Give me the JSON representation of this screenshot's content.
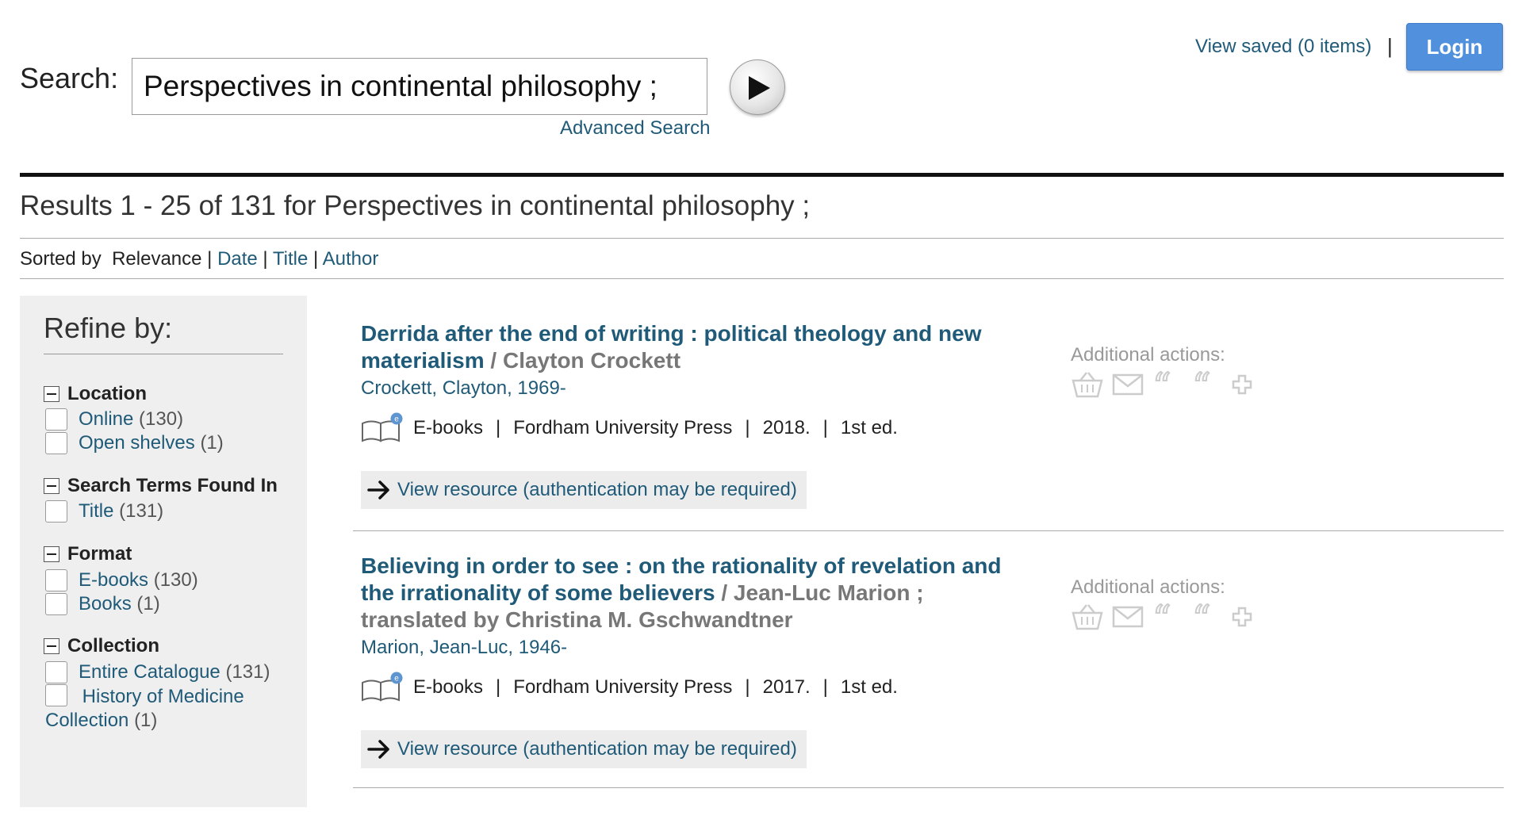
{
  "header": {
    "search_label": "Search:",
    "search_value": "Perspectives in continental philosophy ;",
    "advanced_search": "Advanced Search",
    "view_saved": "View saved (0 items)",
    "separator": "|",
    "login": "Login"
  },
  "results_header": {
    "title": "Results 1 - 25 of 131 for Perspectives in continental philosophy ;",
    "sorted_by": "Sorted by",
    "sort_current": "Relevance",
    "sort_options": [
      "Date",
      "Title",
      "Author"
    ]
  },
  "sidebar": {
    "title": "Refine by:",
    "facets": [
      {
        "heading": "Location",
        "items": [
          {
            "label": "Online",
            "count": "(130)"
          },
          {
            "label": "Open shelves",
            "count": "(1)"
          }
        ]
      },
      {
        "heading": "Search Terms Found In",
        "items": [
          {
            "label": "Title",
            "count": "(131)"
          }
        ]
      },
      {
        "heading": "Format",
        "items": [
          {
            "label": "E-books",
            "count": "(130)"
          },
          {
            "label": "Books",
            "count": "(1)"
          }
        ]
      },
      {
        "heading": "Collection",
        "items": [
          {
            "label": "Entire Catalogue",
            "count": "(131)"
          },
          {
            "label": "History of Medicine Collection",
            "count": "(1)"
          }
        ]
      }
    ]
  },
  "results": [
    {
      "title": "Derrida after the end of writing : political theology and new materialism",
      "responsibility": "/ Clayton Crockett",
      "author": "Crockett, Clayton, 1969-",
      "format": "E-books",
      "publisher": "Fordham University Press",
      "year": "2018.",
      "edition": "1st ed.",
      "view_resource": "View resource (authentication may be required)",
      "additional_actions": "Additional actions:"
    },
    {
      "title": "Believing in order to see : on the rationality of revelation and the irrationality of some believers",
      "responsibility": "/ Jean-Luc Marion ; translated by Christina M. Gschwandtner",
      "author": "Marion, Jean-Luc, 1946-",
      "format": "E-books",
      "publisher": "Fordham University Press",
      "year": "2017.",
      "edition": "1st ed.",
      "view_resource": "View resource (authentication may be required)",
      "additional_actions": "Additional actions:"
    }
  ],
  "icons": {
    "go": "play-icon",
    "format": "ebook-icon",
    "arrow": "arrow-right-icon",
    "actions": [
      "basket-icon",
      "email-icon",
      "cite-icon",
      "export-citation-icon",
      "add-icon"
    ]
  },
  "colors": {
    "link": "#1f5a78",
    "login_bg": "#5190dd",
    "sidebar_bg": "#efefef",
    "muted": "#777777"
  }
}
